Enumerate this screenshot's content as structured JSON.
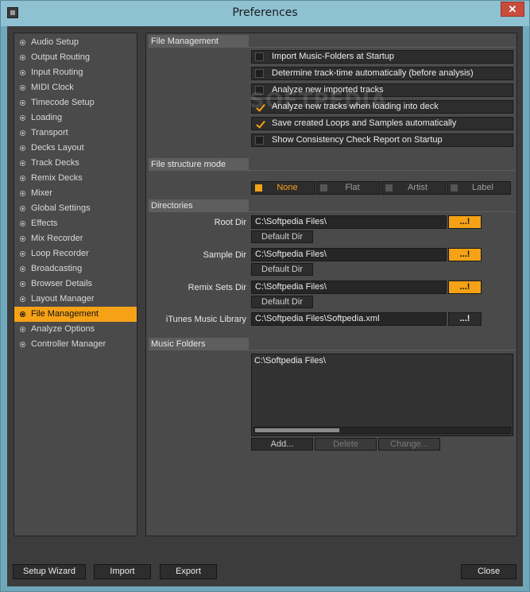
{
  "window": {
    "title": "Preferences",
    "close_glyph": "✕",
    "app_icon": "traktor-app-icon"
  },
  "sidebar": {
    "items": [
      {
        "label": "Audio Setup"
      },
      {
        "label": "Output Routing"
      },
      {
        "label": "Input Routing"
      },
      {
        "label": "MIDI Clock"
      },
      {
        "label": "Timecode Setup"
      },
      {
        "label": "Loading"
      },
      {
        "label": "Transport"
      },
      {
        "label": "Decks Layout"
      },
      {
        "label": "Track Decks"
      },
      {
        "label": "Remix Decks"
      },
      {
        "label": "Mixer"
      },
      {
        "label": "Global Settings"
      },
      {
        "label": "Effects"
      },
      {
        "label": "Mix Recorder"
      },
      {
        "label": "Loop Recorder"
      },
      {
        "label": "Broadcasting"
      },
      {
        "label": "Browser Details"
      },
      {
        "label": "Layout Manager"
      },
      {
        "label": "File Management",
        "active": true
      },
      {
        "label": "Analyze Options"
      },
      {
        "label": "Controller Manager"
      }
    ]
  },
  "file_management": {
    "header": "File Management",
    "options": [
      {
        "label": "Import Music-Folders at Startup",
        "checked": false
      },
      {
        "label": "Determine track-time automatically (before analysis)",
        "checked": false
      },
      {
        "label": "Analyze new imported tracks",
        "checked": false
      },
      {
        "label": "Analyze new tracks when loading into deck",
        "checked": true
      },
      {
        "label": "Save created Loops and Samples automatically",
        "checked": true
      },
      {
        "label": "Show Consistency Check Report on Startup",
        "checked": false
      }
    ]
  },
  "structure_mode": {
    "header": "File structure mode",
    "options": [
      {
        "label": "None",
        "selected": true
      },
      {
        "label": "Flat",
        "selected": false
      },
      {
        "label": "Artist",
        "selected": false
      },
      {
        "label": "Label",
        "selected": false
      }
    ]
  },
  "directories": {
    "header": "Directories",
    "root": {
      "label": "Root Dir",
      "value": "C:\\Softpedia Files\\",
      "browse": "...!",
      "default": "Default Dir"
    },
    "sample": {
      "label": "Sample Dir",
      "value": "C:\\Softpedia Files\\",
      "browse": "...!",
      "default": "Default Dir"
    },
    "remix": {
      "label": "Remix Sets Dir",
      "value": "C:\\Softpedia Files\\",
      "browse": "...!",
      "default": "Default Dir"
    },
    "itunes": {
      "label": "iTunes Music Library",
      "value": "C:\\Softpedia Files\\Softpedia.xml",
      "browse": "...!"
    }
  },
  "music_folders": {
    "header": "Music Folders",
    "items": [
      "C:\\Softpedia Files\\"
    ],
    "add": "Add...",
    "delete": "Delete",
    "change": "Change..."
  },
  "footer": {
    "setup_wizard": "Setup Wizard",
    "import": "Import",
    "export": "Export",
    "close": "Close"
  },
  "watermark": "SOFTPEDIA",
  "colors": {
    "accent": "#f5a216",
    "panel": "#4a4a4a",
    "button": "#2d2d2d"
  }
}
